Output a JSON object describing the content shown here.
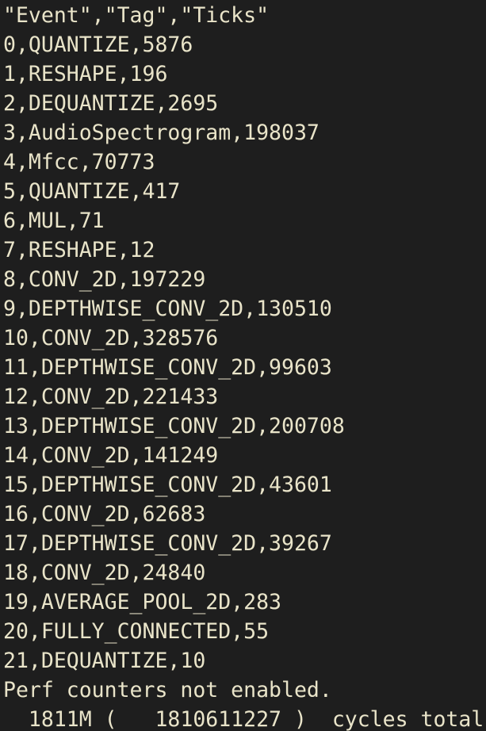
{
  "terminal": {
    "lines": [
      "\"Event\",\"Tag\",\"Ticks\"",
      "0,QUANTIZE,5876",
      "1,RESHAPE,196",
      "2,DEQUANTIZE,2695",
      "3,AudioSpectrogram,198037",
      "4,Mfcc,70773",
      "5,QUANTIZE,417",
      "6,MUL,71",
      "7,RESHAPE,12",
      "8,CONV_2D,197229",
      "9,DEPTHWISE_CONV_2D,130510",
      "10,CONV_2D,328576",
      "11,DEPTHWISE_CONV_2D,99603",
      "12,CONV_2D,221433",
      "13,DEPTHWISE_CONV_2D,200708",
      "14,CONV_2D,141249",
      "15,DEPTHWISE_CONV_2D,43601",
      "16,CONV_2D,62683",
      "17,DEPTHWISE_CONV_2D,39267",
      "18,CONV_2D,24840",
      "19,AVERAGE_POOL_2D,283",
      "20,FULLY_CONNECTED,55",
      "21,DEQUANTIZE,10",
      "Perf counters not enabled.",
      "  1811M (   1810611227 )  cycles total"
    ],
    "colors": {
      "background": "#1e1e1e",
      "text": "#e9e4c9"
    }
  }
}
